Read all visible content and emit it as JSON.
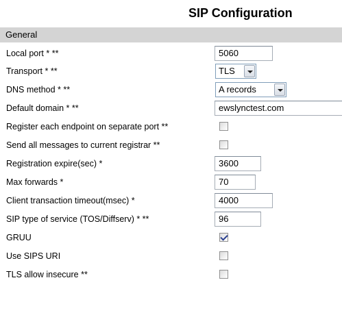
{
  "title": "SIP Configuration",
  "section": "General",
  "fields": {
    "local_port": {
      "label": "Local port * **",
      "value": "5060"
    },
    "transport": {
      "label": "Transport * **",
      "value": "TLS"
    },
    "dns_method": {
      "label": "DNS method * **",
      "value": "A records"
    },
    "default_domain": {
      "label": "Default domain * **",
      "value": "ewslynctest.com"
    },
    "register_separate_port": {
      "label": "Register each endpoint on separate port **",
      "checked": false
    },
    "send_to_current_registrar": {
      "label": "Send all messages to current registrar **",
      "checked": false
    },
    "registration_expire": {
      "label": "Registration expire(sec) *",
      "value": "3600"
    },
    "max_forwards": {
      "label": "Max forwards *",
      "value": "70"
    },
    "client_transaction_timeout": {
      "label": "Client transaction timeout(msec) *",
      "value": "4000"
    },
    "sip_tos": {
      "label": "SIP type of service (TOS/Diffserv) * **",
      "value": "96"
    },
    "gruu": {
      "label": "GRUU",
      "checked": true
    },
    "use_sips_uri": {
      "label": "Use SIPS URI",
      "checked": false
    },
    "tls_allow_insecure": {
      "label": "TLS allow insecure **",
      "checked": false
    }
  }
}
